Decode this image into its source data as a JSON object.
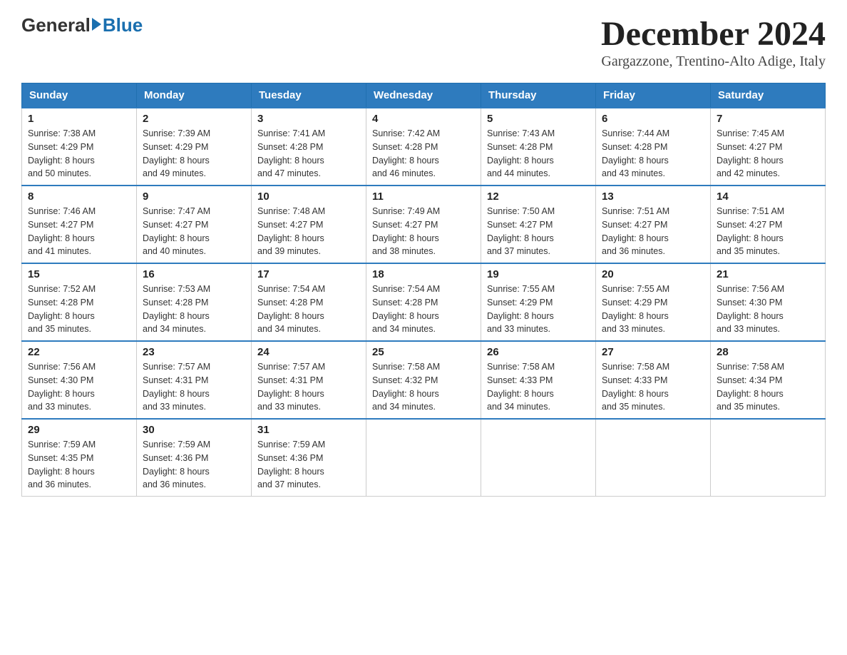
{
  "logo": {
    "general": "General",
    "blue": "Blue"
  },
  "header": {
    "month_year": "December 2024",
    "location": "Gargazzone, Trentino-Alto Adige, Italy"
  },
  "columns": [
    "Sunday",
    "Monday",
    "Tuesday",
    "Wednesday",
    "Thursday",
    "Friday",
    "Saturday"
  ],
  "weeks": [
    [
      {
        "day": "1",
        "sunrise": "7:38 AM",
        "sunset": "4:29 PM",
        "daylight": "8 hours and 50 minutes."
      },
      {
        "day": "2",
        "sunrise": "7:39 AM",
        "sunset": "4:29 PM",
        "daylight": "8 hours and 49 minutes."
      },
      {
        "day": "3",
        "sunrise": "7:41 AM",
        "sunset": "4:28 PM",
        "daylight": "8 hours and 47 minutes."
      },
      {
        "day": "4",
        "sunrise": "7:42 AM",
        "sunset": "4:28 PM",
        "daylight": "8 hours and 46 minutes."
      },
      {
        "day": "5",
        "sunrise": "7:43 AM",
        "sunset": "4:28 PM",
        "daylight": "8 hours and 44 minutes."
      },
      {
        "day": "6",
        "sunrise": "7:44 AM",
        "sunset": "4:28 PM",
        "daylight": "8 hours and 43 minutes."
      },
      {
        "day": "7",
        "sunrise": "7:45 AM",
        "sunset": "4:27 PM",
        "daylight": "8 hours and 42 minutes."
      }
    ],
    [
      {
        "day": "8",
        "sunrise": "7:46 AM",
        "sunset": "4:27 PM",
        "daylight": "8 hours and 41 minutes."
      },
      {
        "day": "9",
        "sunrise": "7:47 AM",
        "sunset": "4:27 PM",
        "daylight": "8 hours and 40 minutes."
      },
      {
        "day": "10",
        "sunrise": "7:48 AM",
        "sunset": "4:27 PM",
        "daylight": "8 hours and 39 minutes."
      },
      {
        "day": "11",
        "sunrise": "7:49 AM",
        "sunset": "4:27 PM",
        "daylight": "8 hours and 38 minutes."
      },
      {
        "day": "12",
        "sunrise": "7:50 AM",
        "sunset": "4:27 PM",
        "daylight": "8 hours and 37 minutes."
      },
      {
        "day": "13",
        "sunrise": "7:51 AM",
        "sunset": "4:27 PM",
        "daylight": "8 hours and 36 minutes."
      },
      {
        "day": "14",
        "sunrise": "7:51 AM",
        "sunset": "4:27 PM",
        "daylight": "8 hours and 35 minutes."
      }
    ],
    [
      {
        "day": "15",
        "sunrise": "7:52 AM",
        "sunset": "4:28 PM",
        "daylight": "8 hours and 35 minutes."
      },
      {
        "day": "16",
        "sunrise": "7:53 AM",
        "sunset": "4:28 PM",
        "daylight": "8 hours and 34 minutes."
      },
      {
        "day": "17",
        "sunrise": "7:54 AM",
        "sunset": "4:28 PM",
        "daylight": "8 hours and 34 minutes."
      },
      {
        "day": "18",
        "sunrise": "7:54 AM",
        "sunset": "4:28 PM",
        "daylight": "8 hours and 34 minutes."
      },
      {
        "day": "19",
        "sunrise": "7:55 AM",
        "sunset": "4:29 PM",
        "daylight": "8 hours and 33 minutes."
      },
      {
        "day": "20",
        "sunrise": "7:55 AM",
        "sunset": "4:29 PM",
        "daylight": "8 hours and 33 minutes."
      },
      {
        "day": "21",
        "sunrise": "7:56 AM",
        "sunset": "4:30 PM",
        "daylight": "8 hours and 33 minutes."
      }
    ],
    [
      {
        "day": "22",
        "sunrise": "7:56 AM",
        "sunset": "4:30 PM",
        "daylight": "8 hours and 33 minutes."
      },
      {
        "day": "23",
        "sunrise": "7:57 AM",
        "sunset": "4:31 PM",
        "daylight": "8 hours and 33 minutes."
      },
      {
        "day": "24",
        "sunrise": "7:57 AM",
        "sunset": "4:31 PM",
        "daylight": "8 hours and 33 minutes."
      },
      {
        "day": "25",
        "sunrise": "7:58 AM",
        "sunset": "4:32 PM",
        "daylight": "8 hours and 34 minutes."
      },
      {
        "day": "26",
        "sunrise": "7:58 AM",
        "sunset": "4:33 PM",
        "daylight": "8 hours and 34 minutes."
      },
      {
        "day": "27",
        "sunrise": "7:58 AM",
        "sunset": "4:33 PM",
        "daylight": "8 hours and 35 minutes."
      },
      {
        "day": "28",
        "sunrise": "7:58 AM",
        "sunset": "4:34 PM",
        "daylight": "8 hours and 35 minutes."
      }
    ],
    [
      {
        "day": "29",
        "sunrise": "7:59 AM",
        "sunset": "4:35 PM",
        "daylight": "8 hours and 36 minutes."
      },
      {
        "day": "30",
        "sunrise": "7:59 AM",
        "sunset": "4:36 PM",
        "daylight": "8 hours and 36 minutes."
      },
      {
        "day": "31",
        "sunrise": "7:59 AM",
        "sunset": "4:36 PM",
        "daylight": "8 hours and 37 minutes."
      },
      null,
      null,
      null,
      null
    ]
  ],
  "labels": {
    "sunrise": "Sunrise:",
    "sunset": "Sunset:",
    "daylight": "Daylight:"
  }
}
